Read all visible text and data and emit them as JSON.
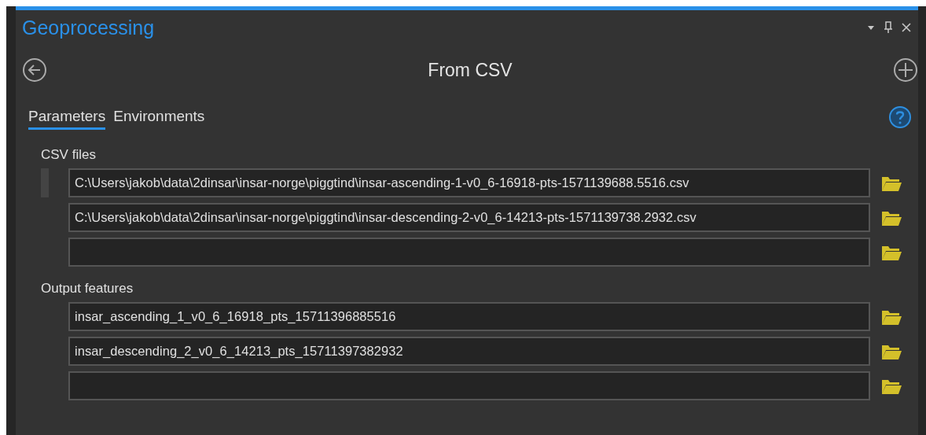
{
  "pane": {
    "title": "Geoprocessing",
    "controls": [
      {
        "kind": "menu"
      },
      {
        "kind": "pin"
      },
      {
        "kind": "close"
      }
    ]
  },
  "tool": {
    "title": "From CSV"
  },
  "tabs": [
    {
      "label": "Parameters",
      "selected": true
    },
    {
      "label": "Environments",
      "selected": false
    }
  ],
  "groups": [
    {
      "label": "CSV files",
      "rows": [
        {
          "value": "C:\\Users\\jakob\\data\\2dinsar\\insar-norge\\piggtind\\insar-ascending-1-v0_6-16918-pts-1571139688.5516.csv",
          "handle": true
        },
        {
          "value": "C:\\Users\\jakob\\data\\2dinsar\\insar-norge\\piggtind\\insar-descending-2-v0_6-14213-pts-1571139738.2932.csv"
        },
        {}
      ]
    },
    {
      "label": "Output features",
      "rows": [
        {
          "value": "insar_ascending_1_v0_6_16918_pts_15711396885516"
        },
        {
          "value": "insar_descending_2_v0_6_14213_pts_15711397382932"
        },
        {}
      ]
    }
  ]
}
